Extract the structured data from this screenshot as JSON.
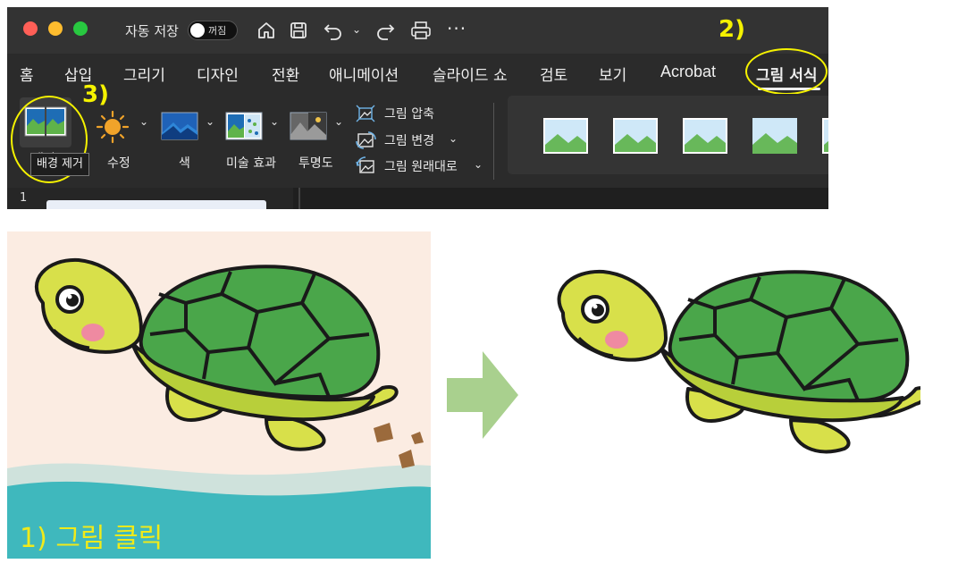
{
  "titlebar": {
    "autosave_label": "자동 저장",
    "autosave_state": "꺼짐"
  },
  "menu": {
    "items": [
      "홈",
      "삽입",
      "그리기",
      "디자인",
      "전환",
      "애니메이션",
      "슬라이드 쇼",
      "검토",
      "보기",
      "Acrobat",
      "그림 서식"
    ],
    "active": "그림 서식"
  },
  "ribbon": {
    "remove_bg_label": "배경 제거",
    "remove_bg_partial": "배경",
    "corrections_label": "수정",
    "color_label": "색",
    "artistic_label": "미술 효과",
    "transparency_label": "투명도",
    "compress_label": "그림 압축",
    "change_label": "그림 변경",
    "reset_label": "그림 원래대로"
  },
  "tooltip": {
    "text": "배경 제거"
  },
  "document": {
    "slide_number": "1"
  },
  "annotations": {
    "step1": "1) 그림 클릭",
    "step2": "2)",
    "step3": "3)",
    "color": "#f5f200"
  },
  "colors": {
    "ribbon_bg": "#2b2b2b",
    "titlebar_bg": "#333333",
    "annotation": "#f5f200",
    "arrow": "#a9d08e",
    "photo_bg": "#fbece2",
    "sea": "#3fb8bd"
  },
  "icons": [
    "home-icon",
    "save-icon",
    "undo-icon",
    "redo-icon",
    "print-icon",
    "more-icon",
    "remove-background-icon",
    "corrections-icon",
    "color-icon",
    "artistic-effects-icon",
    "transparency-icon",
    "compress-icon",
    "change-picture-icon",
    "reset-picture-icon",
    "arrow-right-icon"
  ]
}
